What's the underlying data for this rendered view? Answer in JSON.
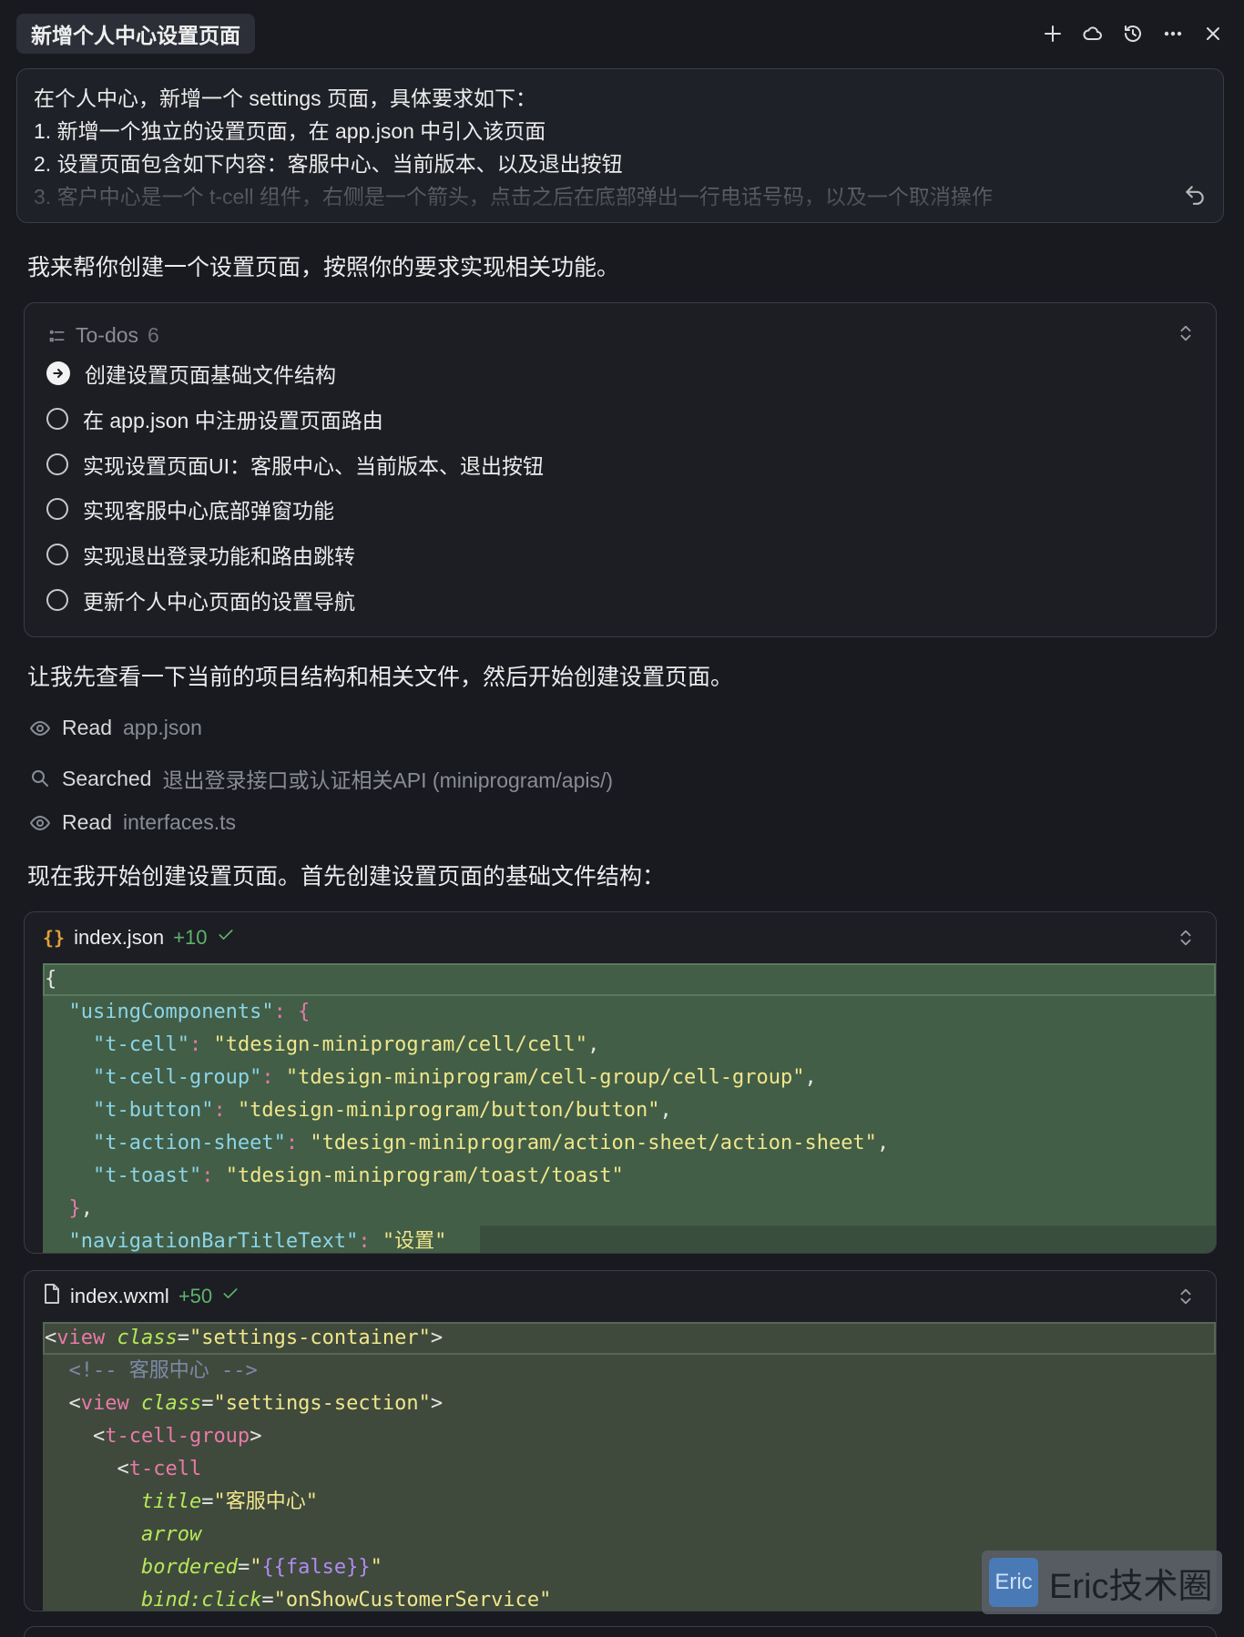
{
  "header": {
    "tab_title": "新增个人中心设置页面",
    "icons": [
      "plus-icon",
      "cloud-icon",
      "history-icon",
      "more-icon",
      "close-icon"
    ]
  },
  "prompt": {
    "lines": [
      "在个人中心，新增一个 settings 页面，具体要求如下：",
      "1.  新增一个独立的设置页面，在 app.json 中引入该页面",
      "2. 设置页面包含如下内容：客服中心、当前版本、以及退出按钮",
      "3. 客户中心是一个 t-cell 组件，右侧是一个箭头，点击之后在底部弹出一行电话号码，以及一个取消操作"
    ]
  },
  "messages": {
    "intro": "我来帮你创建一个设置页面，按照你的要求实现相关功能。",
    "check_structure": "让我先查看一下当前的项目结构和相关文件，然后开始创建设置页面。",
    "start_create": "现在我开始创建设置页面。首先创建设置页面的基础文件结构："
  },
  "todos": {
    "label": "To-dos",
    "count": "6",
    "items": [
      {
        "label": "创建设置页面基础文件结构",
        "status": "in-progress"
      },
      {
        "label": "在 app.json 中注册设置页面路由",
        "status": "pending"
      },
      {
        "label": "实现设置页面UI：客服中心、当前版本、退出按钮",
        "status": "pending"
      },
      {
        "label": "实现客服中心底部弹窗功能",
        "status": "pending"
      },
      {
        "label": "实现退出登录功能和路由跳转",
        "status": "pending"
      },
      {
        "label": "更新个人中心页面的设置导航",
        "status": "pending"
      }
    ]
  },
  "tools": [
    {
      "verb": "Read",
      "target": "app.json",
      "icon": "eye-icon"
    },
    {
      "verb": "Searched",
      "target": "退出登录接口或认证相关API (miniprogram/apis/)",
      "icon": "search-icon"
    },
    {
      "verb": "Read",
      "target": "interfaces.ts",
      "icon": "eye-icon"
    }
  ],
  "files": [
    {
      "name": "index.json",
      "diff": "+10",
      "icon": "braces-icon"
    },
    {
      "name": "index.wxml",
      "diff": "+50",
      "icon": "file-icon"
    }
  ],
  "code_json": {
    "open": "{",
    "key_using": "\"usingComponents\"",
    "c1_key": "\"t-cell\"",
    "c1_val": "\"tdesign-miniprogram/cell/cell\"",
    "c2_key": "\"t-cell-group\"",
    "c2_val": "\"tdesign-miniprogram/cell-group/cell-group\"",
    "c3_key": "\"t-button\"",
    "c3_val": "\"tdesign-miniprogram/button/button\"",
    "c4_key": "\"t-action-sheet\"",
    "c4_val": "\"tdesign-miniprogram/action-sheet/action-sheet\"",
    "c5_key": "\"t-toast\"",
    "c5_val": "\"tdesign-miniprogram/toast/toast\"",
    "nav_key": "\"navigationBarTitleText\"",
    "nav_val": "\"设置\""
  },
  "code_wxml": {
    "container_class": "\"settings-container\"",
    "comment": "<!-- 客服中心 -->",
    "section_class": "\"settings-section\"",
    "cell_group": "t-cell-group",
    "cell": "t-cell",
    "title_attr": "title",
    "title_val": "\"客服中心\"",
    "arrow_attr": "arrow",
    "bordered_attr": "bordered",
    "bordered_val": "{{false}}",
    "bind_attr": "bind:click",
    "bind_val": "\"onShowCustomerService\""
  },
  "watermark": {
    "logo": "Eric",
    "text": "Eric技术圈"
  }
}
